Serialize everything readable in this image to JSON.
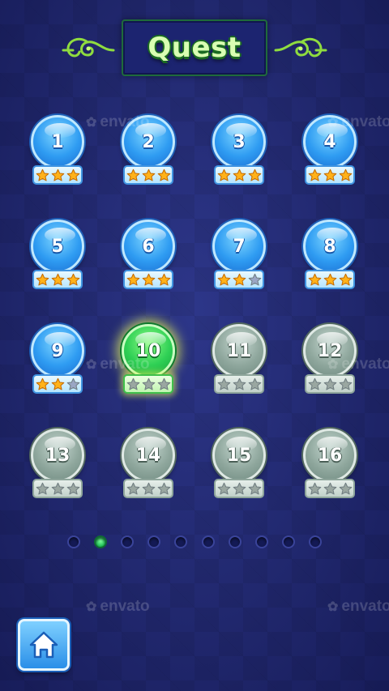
{
  "header": {
    "title": "Quest"
  },
  "levels": [
    {
      "label": "1",
      "state": "unlocked",
      "stars": 3
    },
    {
      "label": "2",
      "state": "unlocked",
      "stars": 3
    },
    {
      "label": "3",
      "state": "unlocked",
      "stars": 3
    },
    {
      "label": "4",
      "state": "unlocked",
      "stars": 3
    },
    {
      "label": "5",
      "state": "unlocked",
      "stars": 3
    },
    {
      "label": "6",
      "state": "unlocked",
      "stars": 3
    },
    {
      "label": "7",
      "state": "unlocked",
      "stars": 2
    },
    {
      "label": "8",
      "state": "unlocked",
      "stars": 3
    },
    {
      "label": "9",
      "state": "unlocked",
      "stars": 2
    },
    {
      "label": "10",
      "state": "current",
      "stars": 0
    },
    {
      "label": "11",
      "state": "locked",
      "stars": 0
    },
    {
      "label": "12",
      "state": "locked",
      "stars": 0
    },
    {
      "label": "13",
      "state": "locked",
      "stars": 0
    },
    {
      "label": "14",
      "state": "locked",
      "stars": 0
    },
    {
      "label": "15",
      "state": "locked",
      "stars": 0
    },
    {
      "label": "16",
      "state": "locked",
      "stars": 0
    }
  ],
  "max_stars": 3,
  "pagination": {
    "page_count": 10,
    "current_page": 2
  },
  "watermark": {
    "text": "envato",
    "icon": "leaf-icon"
  },
  "home_button": {
    "icon": "home-icon"
  },
  "colors": {
    "background": "#28317e",
    "star_filled": "#ffb21a",
    "star_empty_blue": "#9aa6c4",
    "star_empty_grey": "#9aa7a1",
    "title_text": "#d9ffb2",
    "accent_green": "#2fd055"
  }
}
